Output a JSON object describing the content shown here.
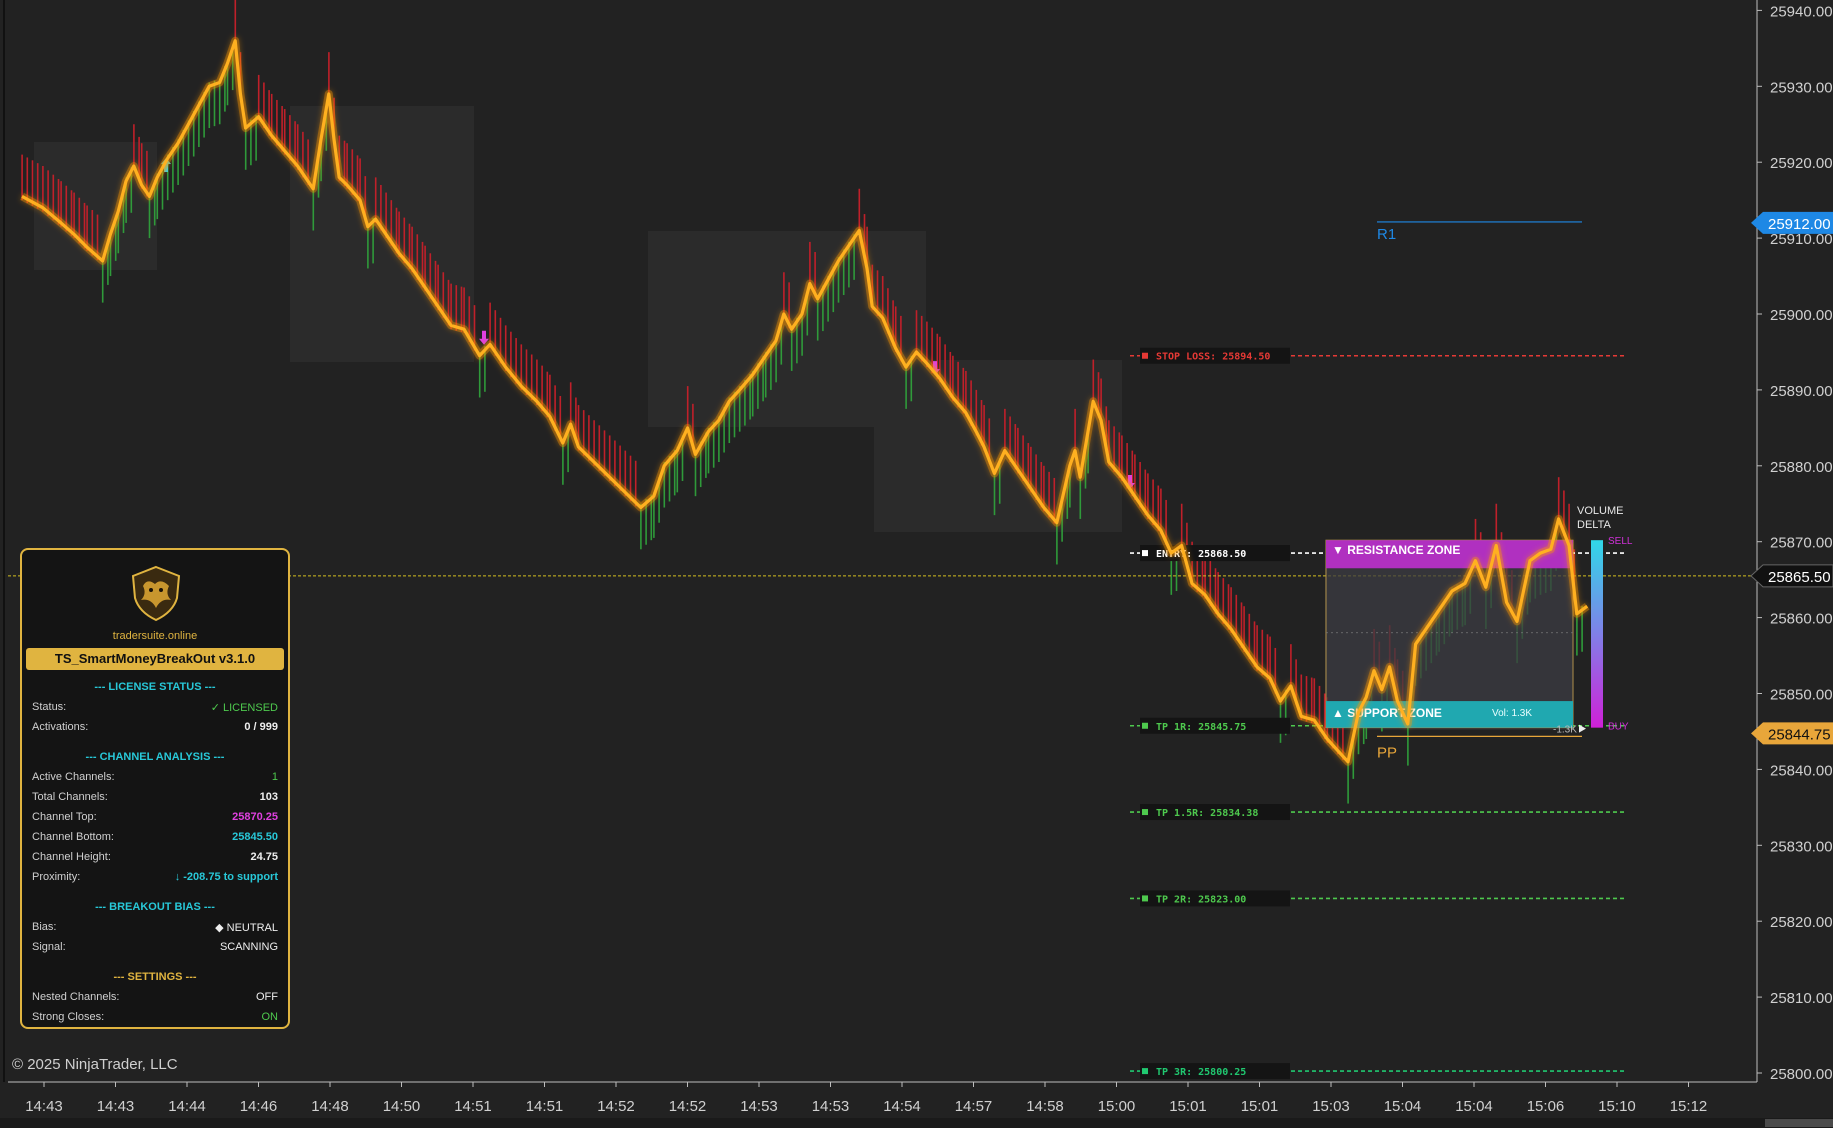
{
  "chart_data": {
    "type": "line",
    "price_axis": {
      "min": 25800,
      "max": 25940,
      "ticks": [
        "25940.00",
        "25930.00",
        "25920.00",
        "25910.00",
        "25900.00",
        "25890.00",
        "25880.00",
        "25870.00",
        "25860.00",
        "25850.00",
        "25840.00",
        "25830.00",
        "25820.00",
        "25810.00",
        "25800.00"
      ],
      "tags": [
        {
          "label": "25912.00",
          "value": 25912.0,
          "color": "#1e88e5",
          "text_color": "#ffffff"
        },
        {
          "label": "25865.50",
          "value": 25865.5,
          "color": "#111111",
          "text_color": "#ffffff"
        },
        {
          "label": "25844.75",
          "value": 25844.75,
          "color": "#e8a63a",
          "text_color": "#111111"
        }
      ]
    },
    "time_axis": {
      "ticks": [
        "14:43",
        "14:43",
        "14:44",
        "14:46",
        "14:48",
        "14:50",
        "14:51",
        "14:51",
        "14:52",
        "14:52",
        "14:53",
        "14:53",
        "14:54",
        "14:57",
        "14:58",
        "15:00",
        "15:01",
        "15:01",
        "15:03",
        "15:04",
        "15:04",
        "15:06",
        "15:10",
        "15:12"
      ]
    },
    "price_path": [
      [
        0,
        25915.5
      ],
      [
        8,
        25914
      ],
      [
        15,
        25912.0
      ],
      [
        20,
        25910.5
      ],
      [
        25,
        25908.8
      ],
      [
        31,
        25907.0
      ],
      [
        34,
        25910.5
      ],
      [
        37,
        25913.5
      ],
      [
        40,
        25917.5
      ],
      [
        43,
        25919.5
      ],
      [
        46,
        25917.0
      ],
      [
        49,
        25915.5
      ],
      [
        52,
        25918.0
      ],
      [
        56,
        25920.5
      ],
      [
        60,
        25922.5
      ],
      [
        64,
        25925.0
      ],
      [
        68,
        25927.5
      ],
      [
        72,
        25930.0
      ],
      [
        76,
        25930.5
      ],
      [
        79,
        25933.0
      ],
      [
        82,
        25936.0
      ],
      [
        84,
        25929.0
      ],
      [
        86,
        25924.5
      ],
      [
        91,
        25926.0
      ],
      [
        96,
        25923.5
      ],
      [
        101,
        25921.5
      ],
      [
        106,
        25919.5
      ],
      [
        112,
        25916.5
      ],
      [
        115,
        25923.0
      ],
      [
        118,
        25929.0
      ],
      [
        120,
        25923.0
      ],
      [
        122,
        25918.0
      ],
      [
        125,
        25917.0
      ],
      [
        130,
        25915.0
      ],
      [
        133,
        25911.5
      ],
      [
        136,
        25912.5
      ],
      [
        140,
        25910.5
      ],
      [
        145,
        25908.0
      ],
      [
        150,
        25906.0
      ],
      [
        155,
        25903.5
      ],
      [
        160,
        25901.0
      ],
      [
        165,
        25898.5
      ],
      [
        170,
        25898.0
      ],
      [
        176,
        25894.5
      ],
      [
        180,
        25896.0
      ],
      [
        186,
        25893.0
      ],
      [
        192,
        25890.5
      ],
      [
        198,
        25888.5
      ],
      [
        203,
        25886.5
      ],
      [
        208,
        25883.0
      ],
      [
        211,
        25885.5
      ],
      [
        214,
        25882.5
      ],
      [
        220,
        25880.5
      ],
      [
        226,
        25878.5
      ],
      [
        232,
        25876.5
      ],
      [
        238,
        25874.5
      ],
      [
        243,
        25876.0
      ],
      [
        247,
        25880.0
      ],
      [
        252,
        25882.0
      ],
      [
        256,
        25885.0
      ],
      [
        259,
        25881.5
      ],
      [
        264,
        25884.5
      ],
      [
        268,
        25886.0
      ],
      [
        272,
        25888.5
      ],
      [
        276,
        25890.0
      ],
      [
        281,
        25892.0
      ],
      [
        286,
        25894.5
      ],
      [
        290,
        25896.5
      ],
      [
        293,
        25900.0
      ],
      [
        296,
        25898.0
      ],
      [
        300,
        25900.0
      ],
      [
        303,
        25904.0
      ],
      [
        306,
        25902.0
      ],
      [
        310,
        25904.5
      ],
      [
        314,
        25907.0
      ],
      [
        318,
        25909.0
      ],
      [
        322,
        25911.0
      ],
      [
        325,
        25906.0
      ],
      [
        327,
        25901.0
      ],
      [
        331,
        25899.5
      ],
      [
        336,
        25895.5
      ],
      [
        340,
        25893.0
      ],
      [
        344,
        25895.0
      ],
      [
        348,
        25893.5
      ],
      [
        353,
        25891.5
      ],
      [
        358,
        25889.0
      ],
      [
        363,
        25887.0
      ],
      [
        367,
        25884.5
      ],
      [
        370,
        25882.5
      ],
      [
        374,
        25879.0
      ],
      [
        378,
        25882.0
      ],
      [
        383,
        25879.5
      ],
      [
        388,
        25877.0
      ],
      [
        393,
        25874.5
      ],
      [
        398,
        25872.5
      ],
      [
        403,
        25880.0
      ],
      [
        405,
        25882.0
      ],
      [
        407,
        25878.5
      ],
      [
        410,
        25884.5
      ],
      [
        412,
        25888.5
      ],
      [
        415,
        25886.0
      ],
      [
        418,
        25880.5
      ],
      [
        423,
        25878.5
      ],
      [
        428,
        25876.0
      ],
      [
        433,
        25873.5
      ],
      [
        438,
        25871.5
      ],
      [
        442,
        25868.5
      ],
      [
        446,
        25869.5
      ],
      [
        450,
        25864.5
      ],
      [
        455,
        25863.0
      ],
      [
        460,
        25860.5
      ],
      [
        465,
        25858.5
      ],
      [
        470,
        25856.0
      ],
      [
        475,
        25853.5
      ],
      [
        480,
        25852.0
      ],
      [
        484,
        25849.0
      ],
      [
        488,
        25851.0
      ],
      [
        492,
        25847.0
      ],
      [
        497,
        25846.5
      ],
      [
        502,
        25844.0
      ],
      [
        506,
        25842.5
      ],
      [
        510,
        25841.0
      ],
      [
        514,
        25847.5
      ],
      [
        517,
        25849.5
      ],
      [
        520,
        25853.0
      ],
      [
        523,
        25850.5
      ],
      [
        526,
        25853.5
      ],
      [
        529,
        25849.0
      ],
      [
        533,
        25846.0
      ],
      [
        536,
        25856.5
      ],
      [
        540,
        25858.5
      ],
      [
        545,
        25861.0
      ],
      [
        550,
        25863.5
      ],
      [
        555,
        25864.5
      ],
      [
        559,
        25867.5
      ],
      [
        563,
        25864.0
      ],
      [
        567,
        25869.5
      ],
      [
        571,
        25862.0
      ],
      [
        575,
        25859.5
      ],
      [
        580,
        25867.5
      ],
      [
        584,
        25868.5
      ],
      [
        588,
        25869.0
      ],
      [
        591,
        25873.0
      ],
      [
        595,
        25869.5
      ],
      [
        598,
        25860.5
      ],
      [
        602,
        25861.5
      ]
    ],
    "levels": [
      {
        "label": "STOP LOSS: 25894.50",
        "value": 25894.5,
        "color": "#e53935"
      },
      {
        "label": "ENTRY: 25868.50",
        "value": 25868.5,
        "color": "#ffffff"
      },
      {
        "label": "TP 1R: 25845.75",
        "value": 25845.75,
        "color": "#4ec94e"
      },
      {
        "label": "TP 1.5R: 25834.38",
        "value": 25834.38,
        "color": "#4ec94e"
      },
      {
        "label": "TP 2R: 25823.00",
        "value": 25823.0,
        "color": "#4ec94e"
      },
      {
        "label": "TP 3R: 25800.25",
        "value": 25800.25,
        "color": "#20c870"
      }
    ],
    "resistance_zone": {
      "label": "▼ RESISTANCE ZONE",
      "top": 25870.2,
      "bottom": 25866.5,
      "color": "#b030c0"
    },
    "support_zone": {
      "label": "▲ SUPPORT ZONE",
      "vol": "Vol: 1.3K",
      "top": 25849.0,
      "bottom": 25845.5,
      "color": "#20a8b0"
    },
    "pivot_labels": [
      {
        "label": "R1",
        "value": 25912.0,
        "color": "#1e88e5"
      },
      {
        "label": "PP",
        "value": 25844.75,
        "color": "#e8a63a"
      }
    ],
    "volume_delta": {
      "title_1": "VOLUME",
      "title_2": "DELTA",
      "sell": "SELL",
      "buy": "BUY",
      "marker": "-1.3K"
    },
    "signal_arrows": [
      {
        "kind": "up",
        "value": 25919.5,
        "color": "#40d0e0"
      },
      {
        "kind": "down",
        "value": 25897.0,
        "color": "#e040e0"
      },
      {
        "kind": "down",
        "value": 25893.0,
        "color": "#e040e0"
      },
      {
        "kind": "down",
        "value": 25878.0,
        "color": "#e040e0"
      }
    ],
    "current_price": 25865.5,
    "grid": false
  },
  "panel": {
    "site": "tradersuite.online",
    "title": "TS_SmartMoneyBreakOut v3.1.0",
    "license_header": "--- LICENSE STATUS ---",
    "status_label": "Status:",
    "status_value": "✓ LICENSED",
    "activations_label": "Activations:",
    "activations_value": "0 / 999",
    "channel_header": "--- CHANNEL ANALYSIS ---",
    "active_label": "Active Channels:",
    "active_value": "1",
    "total_label": "Total Channels:",
    "total_value": "103",
    "top_label": "Channel Top:",
    "top_value": "25870.25",
    "bottom_label": "Channel Bottom:",
    "bottom_value": "25845.50",
    "height_label": "Channel Height:",
    "height_value": "24.75",
    "proximity_label": "Proximity:",
    "proximity_value": "↓ -208.75 to support",
    "bias_header": "--- BREAKOUT BIAS ---",
    "bias_label": "Bias:",
    "bias_value": "◆ NEUTRAL",
    "signal_label": "Signal:",
    "signal_value": "SCANNING",
    "settings_header": "--- SETTINGS ---",
    "nested_label": "Nested Channels:",
    "nested_value": "OFF",
    "strong_label": "Strong Closes:",
    "strong_value": "ON"
  },
  "footer": {
    "copyright": "© 2025 NinjaTrader, LLC"
  }
}
